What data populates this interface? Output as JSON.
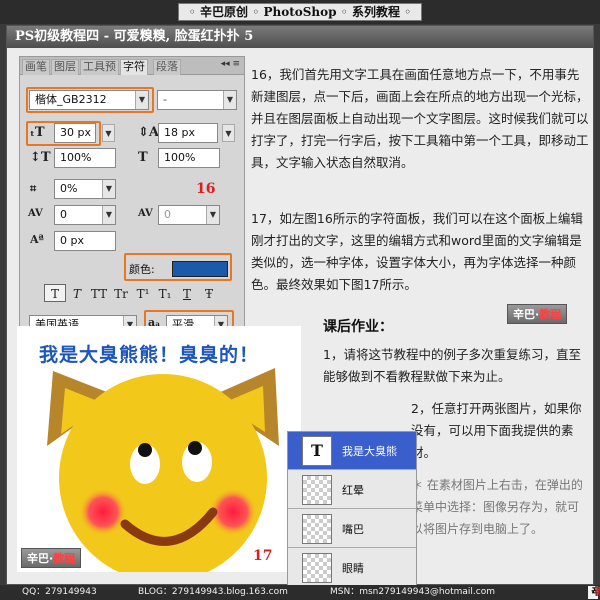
{
  "banner": {
    "title": "◦ 辛巴原创 ◦ PhotoShop ◦ 系列教程 ◦"
  },
  "header": {
    "title": "PS初级教程四 - 可爱糗糗, 脸蛋红扑扑 5"
  },
  "panel": {
    "tabs": [
      "画笔",
      "图层",
      "工具预",
      "字符",
      "段落"
    ],
    "active_tab": "字符",
    "font_family": "楷体_GB2312",
    "font_style": "-",
    "font_size": "30 px",
    "leading": "18 px",
    "vertical_scale": "100%",
    "horizontal_scale": "100%",
    "baseline_shift_pct": "0%",
    "kerning": "0",
    "tracking": "0",
    "baseline_shift": "0 px",
    "color_label": "颜色:",
    "color_value": "#1a5aa8",
    "style_buttons": [
      "T",
      "T",
      "TT",
      "Tr",
      "T¹",
      "T₁",
      "T",
      "Ŧ"
    ],
    "language": "美国英语",
    "antialias_icon": "aₐ",
    "antialias": "平滑",
    "step_number": "16"
  },
  "instructions": {
    "p16": "16，我们首先用文字工具在画面任意地方点一下，不用事先新建图层，点一下后，画面上会在所点的地方出现一个光标，并且在图层面板上自动出现一个文字图层。这时候我们就可以打字了，打完一行字后，按下工具箱中第一个工具，即移动工具，文字输入状态自然取消。",
    "p17": "17，如左图16所示的字符面板，我们可以在这个面板上编辑刚才打出的文字，这里的编辑方式和word里面的文字编辑是类似的，选一种字体，设置字体大小，再为字体选择一种颜色。最终效果如下图17所示。"
  },
  "homework": {
    "title": "课后作业：",
    "item1": "1，请将这节教程中的例子多次重复练习，直至能够做到不看教程默做下来为止。",
    "item2": "2，任意打开两张图片，如果你没有，可以用下面我提供的素材。",
    "note": "＊ 在素材图片上右击，在弹出的菜单中选择：图像另存为，就可以将图片存到电脑上了。"
  },
  "illustration": {
    "caption": "我是大臭熊熊！臭臭的！",
    "step_number": "17"
  },
  "layers": [
    {
      "name": "我是大臭熊",
      "kind": "text",
      "active": true
    },
    {
      "name": "红晕",
      "kind": "pixel",
      "active": false
    },
    {
      "name": "嘴巴",
      "kind": "pixel",
      "active": false
    },
    {
      "name": "眼睛",
      "kind": "pixel",
      "active": false
    }
  ],
  "watermark": {
    "left": "辛巴",
    "right": "教程"
  },
  "footer": {
    "qq": "QQ：279149943",
    "blog": "BLOG：279149943.blog.163.com",
    "msn": "MSN：msn279149943@hotmail.com",
    "brand_left": "辛巴",
    "brand_right": "教程"
  },
  "colors": {
    "accent_orange": "#e87722",
    "text_blue": "#1d55b8",
    "face_yellow": "#f2c81a",
    "ear_brown": "#b8862a",
    "cheek_red": "#ff2a4a"
  }
}
